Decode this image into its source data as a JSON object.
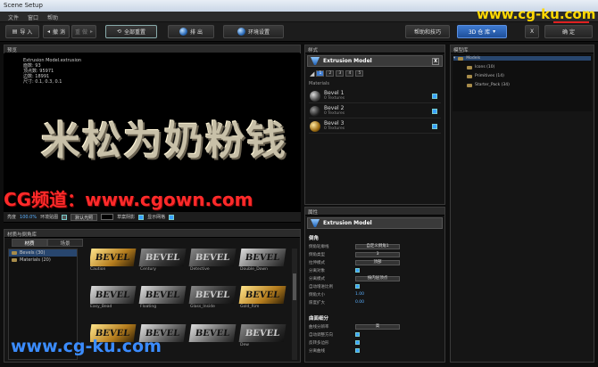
{
  "window": {
    "title": "Scene Setup"
  },
  "menu": [
    "文件",
    "窗口",
    "帮助"
  ],
  "toolbar": {
    "import": "导 入",
    "undo": "撤 消",
    "redo": "重 做",
    "reset_all": "全部重置",
    "render": "排 出",
    "env_settings": "环境设置",
    "help_tips": "帮助和技巧",
    "library_3d": "3D 仓 库",
    "close": "X",
    "ok": "确 定"
  },
  "viewport": {
    "header": "预览",
    "info": [
      "Extrusion Model.extrusion",
      "面数: 93",
      "顶点数: 95971",
      "边数: 18991",
      "尺寸: 0.1, 0.3, 0.1"
    ],
    "text": "米松为奶粉钱"
  },
  "viewport_bar": {
    "brightness_label": "亮度",
    "brightness_value": "100.0%",
    "env_map_label": "环境贴图",
    "env_map_select": "默认光照",
    "ground_shadow_label": "草案阴影",
    "show_grid_label": "显示网格"
  },
  "library": {
    "header": "材质与倒角库",
    "tabs": [
      "材质",
      "场景"
    ],
    "tree": [
      {
        "label": "Bevels (30)"
      },
      {
        "label": "Materials (20)"
      }
    ],
    "thumbs": [
      {
        "label": "Caution"
      },
      {
        "label": "Century"
      },
      {
        "label": "Detective"
      },
      {
        "label": "Double_Down"
      },
      {
        "label": "Easy_Bead"
      },
      {
        "label": "Floating"
      },
      {
        "label": "Glass_Inside"
      },
      {
        "label": "Gold_Rim"
      },
      {
        "label": ""
      },
      {
        "label": ""
      },
      {
        "label": ""
      },
      {
        "label": "Dew"
      }
    ],
    "thumb_text": "BEVEL"
  },
  "style": {
    "header": "样式",
    "model_name": "Extrusion Model",
    "close": "X",
    "tabs": [
      "1",
      "2",
      "3",
      "4",
      "5"
    ],
    "materials_label": "Materials",
    "materials": [
      {
        "name": "Bevel 1",
        "sub": "0 Textures"
      },
      {
        "name": "Bevel 2",
        "sub": "0 Textures"
      },
      {
        "name": "Bevel 3",
        "sub": "0 Textures"
      }
    ]
  },
  "props": {
    "header": "属性",
    "model_name": "Extrusion Model",
    "section1": "倒角",
    "rows1": [
      {
        "k": "倒角轮廓线",
        "v": "自定义倒角1"
      },
      {
        "k": "倒角类型",
        "v": "3"
      },
      {
        "k": "拉伸模式",
        "v": "顶部"
      },
      {
        "k": "分离对象",
        "v": ""
      },
      {
        "k": "分离模式",
        "v": "按内层顶点"
      },
      {
        "k": "自动增进比例",
        "v": ""
      },
      {
        "k": "倒角大小",
        "num": "1.00"
      },
      {
        "k": "厚度扩大",
        "num": "0.00"
      }
    ],
    "section2": "曲面细分",
    "rows2": [
      {
        "k": "曲线分辨率",
        "v": "高"
      },
      {
        "k": "自动调整方向",
        "v": ""
      },
      {
        "k": "反转多边形",
        "v": ""
      },
      {
        "k": "分离曲线",
        "v": ""
      }
    ]
  },
  "models": {
    "header": "模型库",
    "tree": [
      {
        "label": "Models"
      },
      {
        "label": "Icons (10)"
      },
      {
        "label": "Primitives (14)"
      },
      {
        "label": "Starter_Pack (34)"
      }
    ]
  },
  "watermarks": {
    "top": "www.cg-ku.com",
    "middle": "CG频道：www.cgown.com",
    "bottom": "www.cg-ku.com"
  }
}
